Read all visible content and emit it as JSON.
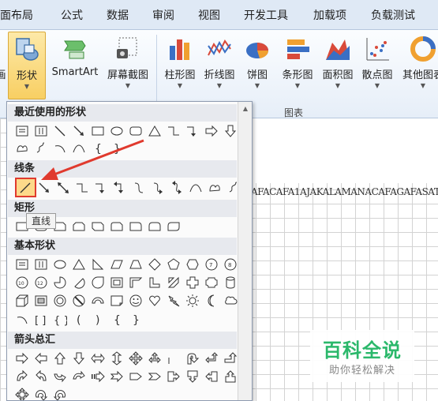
{
  "tabs": [
    "面布局",
    "公式",
    "数据",
    "审阅",
    "视图",
    "开发工具",
    "加载项",
    "负载测试"
  ],
  "ribbon": {
    "buttons": [
      {
        "label": "画",
        "icon": "partial-picture-icon"
      },
      {
        "label": "形状",
        "icon": "shapes-icon"
      },
      {
        "label": "SmartArt",
        "icon": "smartart-icon"
      },
      {
        "label": "屏幕截图",
        "icon": "screenshot-icon"
      },
      {
        "label": "柱形图",
        "icon": "column-chart-icon"
      },
      {
        "label": "折线图",
        "icon": "line-chart-icon"
      },
      {
        "label": "饼图",
        "icon": "pie-chart-icon"
      },
      {
        "label": "条形图",
        "icon": "bar-chart-icon"
      },
      {
        "label": "面积图",
        "icon": "area-chart-icon"
      },
      {
        "label": "散点图",
        "icon": "scatter-chart-icon"
      },
      {
        "label": "其他图表",
        "icon": "other-chart-icon"
      }
    ],
    "group_label": "图表"
  },
  "panel": {
    "sections": [
      {
        "title": "最近使用的形状"
      },
      {
        "title": "线条"
      },
      {
        "title": "矩形"
      },
      {
        "title": "基本形状"
      },
      {
        "title": "箭头总汇"
      }
    ],
    "tooltip": "直线"
  },
  "document": {
    "text": "AFACAFA1AJAKALAMANACAFAGAFASAT"
  },
  "watermark": {
    "title": "百科全说",
    "subtitle": "助你轻松解决"
  },
  "colors": {
    "highlight": "#fdd98a",
    "annotation_red": "#e03a2e",
    "watermark_green": "#2bb86b"
  }
}
